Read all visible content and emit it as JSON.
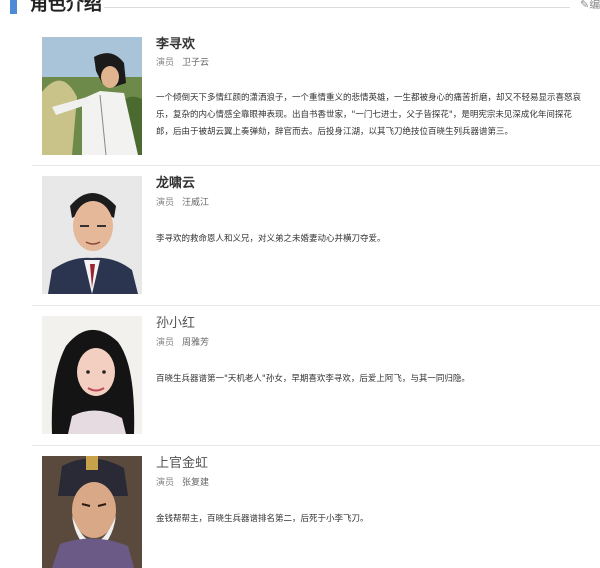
{
  "section": {
    "title": "角色介绍",
    "edit_label": "编"
  },
  "actor_label": "演员",
  "roles": [
    {
      "name": "李寻欢",
      "actor": "卫子云",
      "description": "一个倾倒天下多情红颜的潇洒浪子，一个重情重义的悲情英雄，一生都被身心的痛苦折磨，却又不轻易显示喜怒哀乐，复杂的内心情感全靠眼神表现。出自书香世家，\"一门七进士，父子皆探花\"，是明宪宗未见深成化年间探花郎，后由于被胡云翼上奏弹劾，辞官而去。后投身江湖，以其飞刀绝技位百晓生列兵器谱第三。"
    },
    {
      "name": "龙啸云",
      "actor": "汪威江",
      "description": "李寻欢的救命恩人和义兄，对义弟之未婚妻动心并横刀夺爱。"
    },
    {
      "name": "孙小红",
      "actor": "周雅芳",
      "description": "百晓生兵器谱第一\"天机老人\"孙女，早期喜欢李寻欢，后爱上阿飞，与其一同归隐。"
    },
    {
      "name": "上官金虹",
      "actor": "张复建",
      "description": "金钱帮帮主，百晓生兵器谱排名第二，后死于小李飞刀。"
    }
  ]
}
